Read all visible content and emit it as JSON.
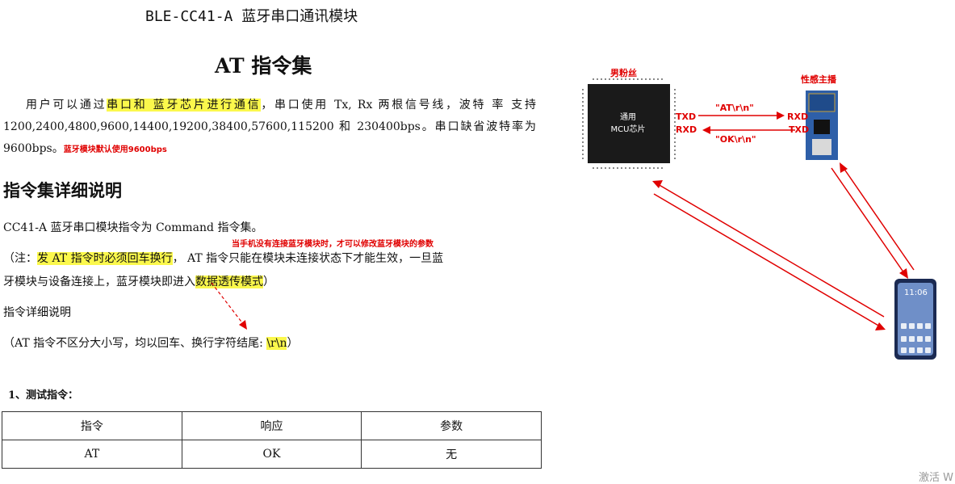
{
  "doc": {
    "title": "BLE-CC41-A 蓝牙串口通讯模块",
    "subtitle": "AT  指令集",
    "intro": {
      "pre": "用户可以通过",
      "hl": "串口和  蓝牙芯片进行通信",
      "rest1": "，串口使用 Tx, Rx 两根信号线，波特 率 支持 1200,2400,4800,9600,14400,19200,38400,57600,115200 和 230400bps。串口缺省波特率为 9600bps。",
      "red_note": "蓝牙模块默认使用9600bps"
    },
    "section_heading": "指令集详细说明",
    "command_line": "CC41-A 蓝牙串口模块指令为  Command  指令集。",
    "red_annotation": "当手机没有连接蓝牙模块时，才可以修改蓝牙模块的参数",
    "note_line": {
      "pre": "（注：",
      "hl1": "发  AT  指令时必须回车换行",
      "mid": "，   AT  指令只能在模块未连接状态下才能生效，一旦蓝",
      "line2_pre": "牙模块与设备连接上，蓝牙模块即进入",
      "hl2": "数据透传模式",
      "line2_post": "）"
    },
    "detail_label": "指令详细说明",
    "case_line": {
      "pre": "（AT 指令不区分大小写，均以回车、换行字符结尾: ",
      "hl": "\\r\\n",
      "post": "）"
    },
    "test_heading": "1、测试指令：",
    "table": {
      "headers": [
        "指令",
        "响应",
        "参数"
      ],
      "rows": [
        [
          "AT",
          "OK",
          "无"
        ]
      ]
    }
  },
  "diagram": {
    "mcu_caption": "男粉丝",
    "mcu_chip_label_1": "通用",
    "mcu_chip_label_2": "MCU芯片",
    "mcu_txd": "TXD",
    "mcu_rxd": "RXD",
    "send_label": "\"AT\\r\\n\"",
    "reply_label": "\"OK\\r\\n\"",
    "ble_caption": "性感主播",
    "ble_rxd": "RXD",
    "ble_txd": "TXD",
    "phone_time": "11:06",
    "colors": {
      "arrow": "#e00000",
      "chip": "#1a1a1a",
      "ble_board": "#2e5fa8"
    }
  },
  "watermark": "激活 W"
}
